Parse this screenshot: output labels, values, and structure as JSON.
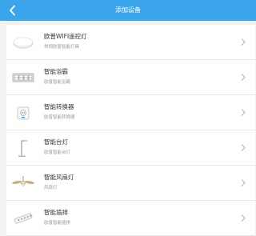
{
  "header": {
    "title": "添加设备",
    "back_icon": "chevron-left-icon",
    "background": "#3ba5ec"
  },
  "devices": [
    {
      "title": "欧普WIFI遥控灯",
      "subtitle": "常规欧普智能灯具",
      "icon": "ceiling-lamp-icon"
    },
    {
      "title": "智能浴霸",
      "subtitle": "欧普智能浴霸",
      "icon": "bath-heater-icon"
    },
    {
      "title": "智能转换器",
      "subtitle": "欧普智能转换器",
      "icon": "smart-plug-icon"
    },
    {
      "title": "智能台灯",
      "subtitle": "欧普智能台灯",
      "icon": "desk-lamp-icon"
    },
    {
      "title": "智能风扇灯",
      "subtitle": "风扇灯",
      "icon": "fan-lamp-icon"
    },
    {
      "title": "智能插排",
      "subtitle": "欧普智能插排",
      "icon": "power-strip-icon"
    }
  ]
}
